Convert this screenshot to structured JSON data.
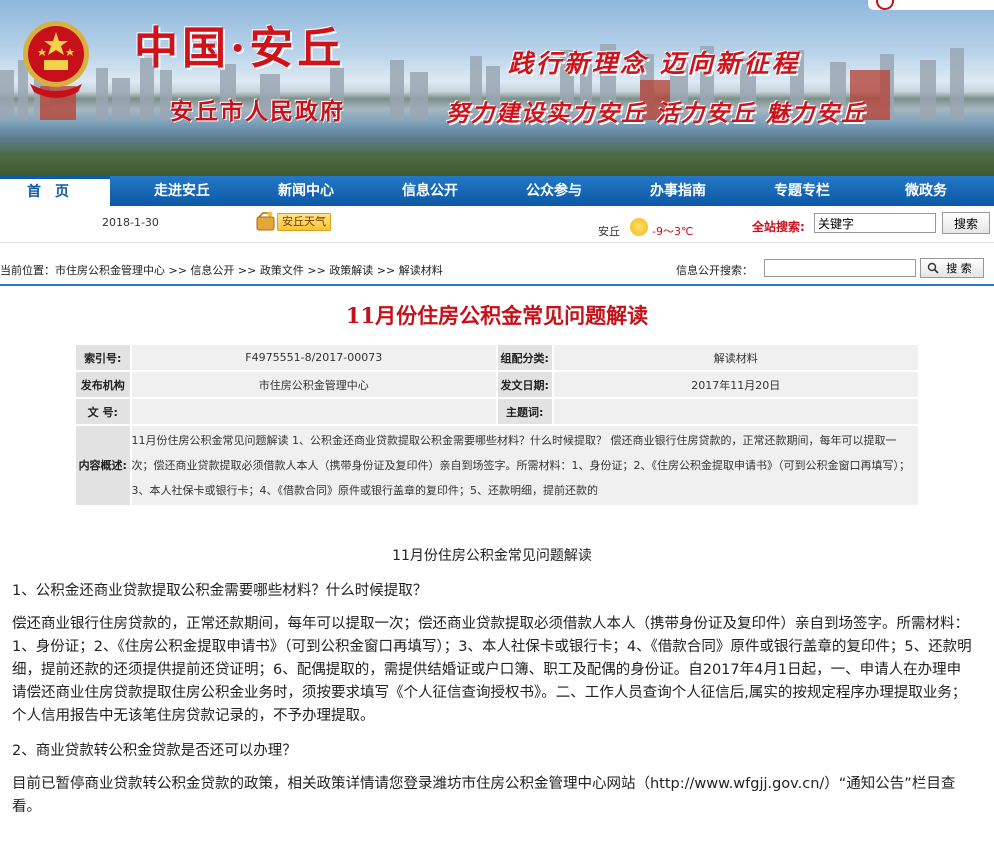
{
  "banner": {
    "title_main": "中国·安丘",
    "title_sub": "安丘市人民政府",
    "slogan_1": "践行新理念  迈向新征程",
    "slogan_2": "努力建设实力安丘 活力安丘 魅力安丘"
  },
  "nav": [
    "首页",
    "走进安丘",
    "新闻中心",
    "信息公开",
    "公众参与",
    "办事指南",
    "专题专栏",
    "微政务"
  ],
  "subbar": {
    "date": "2018-1-30",
    "weather_button": "安丘天气",
    "city": "安丘",
    "temperature": "-9～3℃",
    "search_label": "全站搜索:",
    "search_value": "关键字",
    "search_button": "搜索"
  },
  "breadcrumb": {
    "prefix": "当前位置：",
    "items": [
      "市住房公积金管理中心",
      "信息公开",
      "政策文件",
      "政策解读",
      "解读材料"
    ],
    "separator": " >> ",
    "info_search_label": "信息公开搜索：",
    "info_search_button": "搜 索"
  },
  "article": {
    "title": "11月份住房公积金常见问题解读",
    "meta": {
      "index_label": "索引号:",
      "index_value": "F4975551-8/2017-00073",
      "category_label": "组配分类:",
      "category_value": "解读材料",
      "publisher_label": "发布机构",
      "publisher_value": "市住房公积金管理中心",
      "date_label": "发文日期:",
      "date_value": "2017年11月20日",
      "docno_label": "文 号:",
      "docno_value": "",
      "subject_label": "主题词:",
      "subject_value": "",
      "summary_label": "内容概述:",
      "summary_value": "11月份住房公积金常见问题解读 1、公积金还商业贷款提取公积金需要哪些材料？什么时候提取？ 偿还商业银行住房贷款的，正常还款期间，每年可以提取一次；偿还商业贷款提取必须借款人本人（携带身份证及复印件）亲自到场签字。所需材料：1、身份证；2、《住房公积金提取申请书》（可到公积金窗口再填写）；3、本人社保卡或银行卡；4、《借款合同》原件或银行盖章的复印件；5、还款明细，提前还款的"
    },
    "body_title": "11月份住房公积金常见问题解读",
    "paragraphs": [
      "1、公积金还商业贷款提取公积金需要哪些材料？什么时候提取？",
      "偿还商业银行住房贷款的，正常还款期间，每年可以提取一次；偿还商业贷款提取必须借款人本人（携带身份证及复印件）亲自到场签字。所需材料：1、身份证；2、《住房公积金提取申请书》（可到公积金窗口再填写）；3、本人社保卡或银行卡；4、《借款合同》原件或银行盖章的复印件；5、还款明细，提前还款的还须提供提前还贷证明；6、配偶提取的，需提供结婚证或户口簿、职工及配偶的身份证。自2017年4月1日起，一、申请人在办理申请偿还商业住房贷款提取住房公积金业务时，须按要求填写《个人征信查询授权书》。二、工作人员查询个人征信后,属实的按规定程序办理提取业务；个人信用报告中无该笔住房贷款记录的，不予办理提取。",
      "2、商业贷款转公积金贷款是否还可以办理？",
      "目前已暂停商业贷款转公积金贷款的政策，相关政策详情请您登录潍坊市住房公积金管理中心网站（http://www.wfgjj.gov.cn/）“通知公告”栏目查看。"
    ]
  },
  "colors": {
    "nav_blue": "#0c58a4",
    "title_red": "#c8101a"
  }
}
